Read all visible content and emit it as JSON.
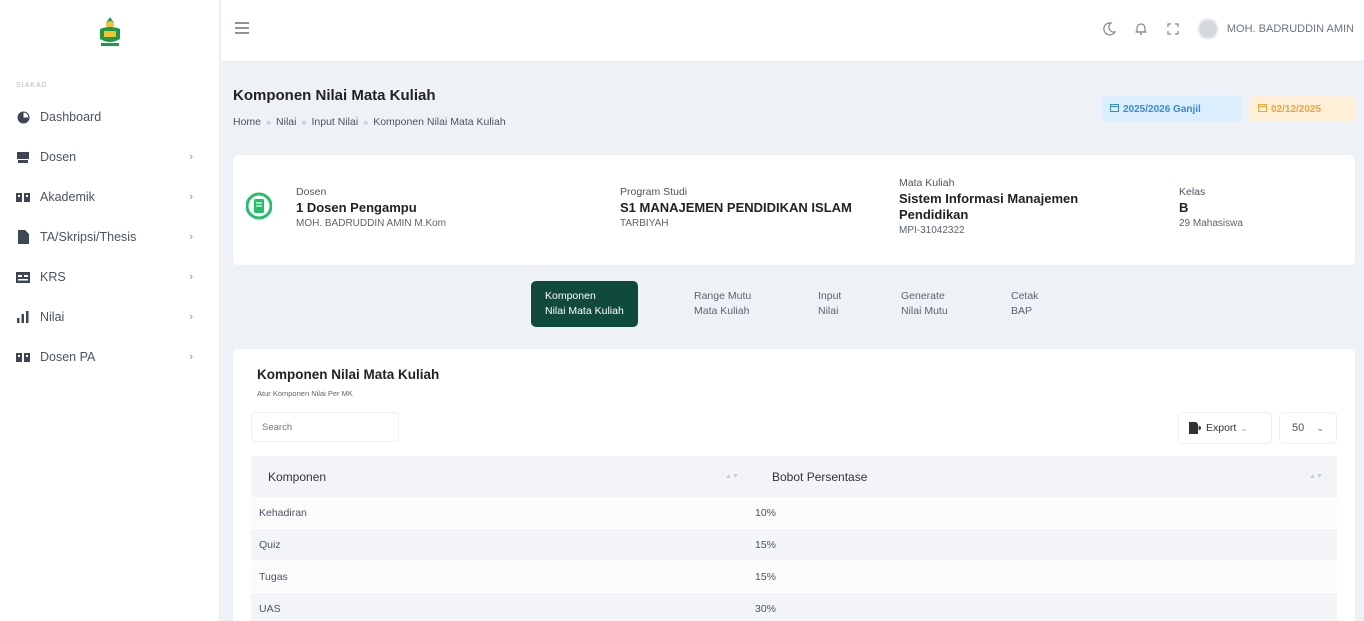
{
  "sidebar": {
    "section": "SIAKAD",
    "items": [
      {
        "label": "Dashboard",
        "icon": "dashboard-icon",
        "has_children": false
      },
      {
        "label": "Dosen",
        "icon": "dosen-icon",
        "has_children": true
      },
      {
        "label": "Akademik",
        "icon": "akademik-icon",
        "has_children": true
      },
      {
        "label": "TA/Skripsi/Thesis",
        "icon": "document-icon",
        "has_children": true
      },
      {
        "label": "KRS",
        "icon": "krs-icon",
        "has_children": true
      },
      {
        "label": "Nilai",
        "icon": "chart-icon",
        "has_children": true
      },
      {
        "label": "Dosen PA",
        "icon": "dosen-pa-icon",
        "has_children": true
      }
    ]
  },
  "topbar": {
    "user_name": "MOH. BADRUDDIN AMIN"
  },
  "page": {
    "title": "Komponen Nilai Mata Kuliah",
    "breadcrumb": [
      "Home",
      "Nilai",
      "Input Nilai",
      "Komponen Nilai Mata Kuliah"
    ],
    "semester_badge": "2025/2026 Ganjil",
    "date_badge": "02/12/2025"
  },
  "info": {
    "dosen_label": "Dosen",
    "dosen_value": "1 Dosen Pengampu",
    "dosen_name": "MOH. BADRUDDIN AMIN M.Kom",
    "prodi_label": "Program Studi",
    "prodi_value": "S1 MANAJEMEN PENDIDIKAN ISLAM",
    "prodi_fakultas": "TARBIYAH",
    "mk_label": "Mata Kuliah",
    "mk_value_line1": "Sistem Informasi Manajemen",
    "mk_value_line2": "Pendidikan",
    "mk_code": "MPI-31042322",
    "kelas_label": "Kelas",
    "kelas_value": "B",
    "kelas_count": "29 Mahasiswa"
  },
  "tabs": [
    {
      "line1": "Komponen",
      "line2": "Nilai Mata Kuliah",
      "active": true
    },
    {
      "line1": "Range Mutu",
      "line2": "Mata Kuliah",
      "active": false
    },
    {
      "line1": "Input",
      "line2": "Nilai",
      "active": false
    },
    {
      "line1": "Generate",
      "line2": "Nilai Mutu",
      "active": false
    },
    {
      "line1": "Cetak",
      "line2": "BAP",
      "active": false
    }
  ],
  "table_card": {
    "title": "Komponen Nilai Mata Kuliah",
    "subtitle": "Atur Komponen Nilai Per MK",
    "search_placeholder": "Search",
    "export_label": "Export",
    "per_page": "50",
    "columns": [
      "Komponen",
      "Bobot Persentase"
    ],
    "rows": [
      {
        "komponen": "Kehadiran",
        "bobot": "10%"
      },
      {
        "komponen": "Quiz",
        "bobot": "15%"
      },
      {
        "komponen": "Tugas",
        "bobot": "15%"
      },
      {
        "komponen": "UAS",
        "bobot": "30%"
      }
    ]
  },
  "colors": {
    "accent": "#0f4a3c",
    "logo_green": "#1a9a4a",
    "badge_blue_bg": "#dbeefe",
    "badge_blue_text": "#3a8ad8",
    "badge_orange_bg": "#feefd9",
    "badge_orange_text": "#f3a43b"
  }
}
